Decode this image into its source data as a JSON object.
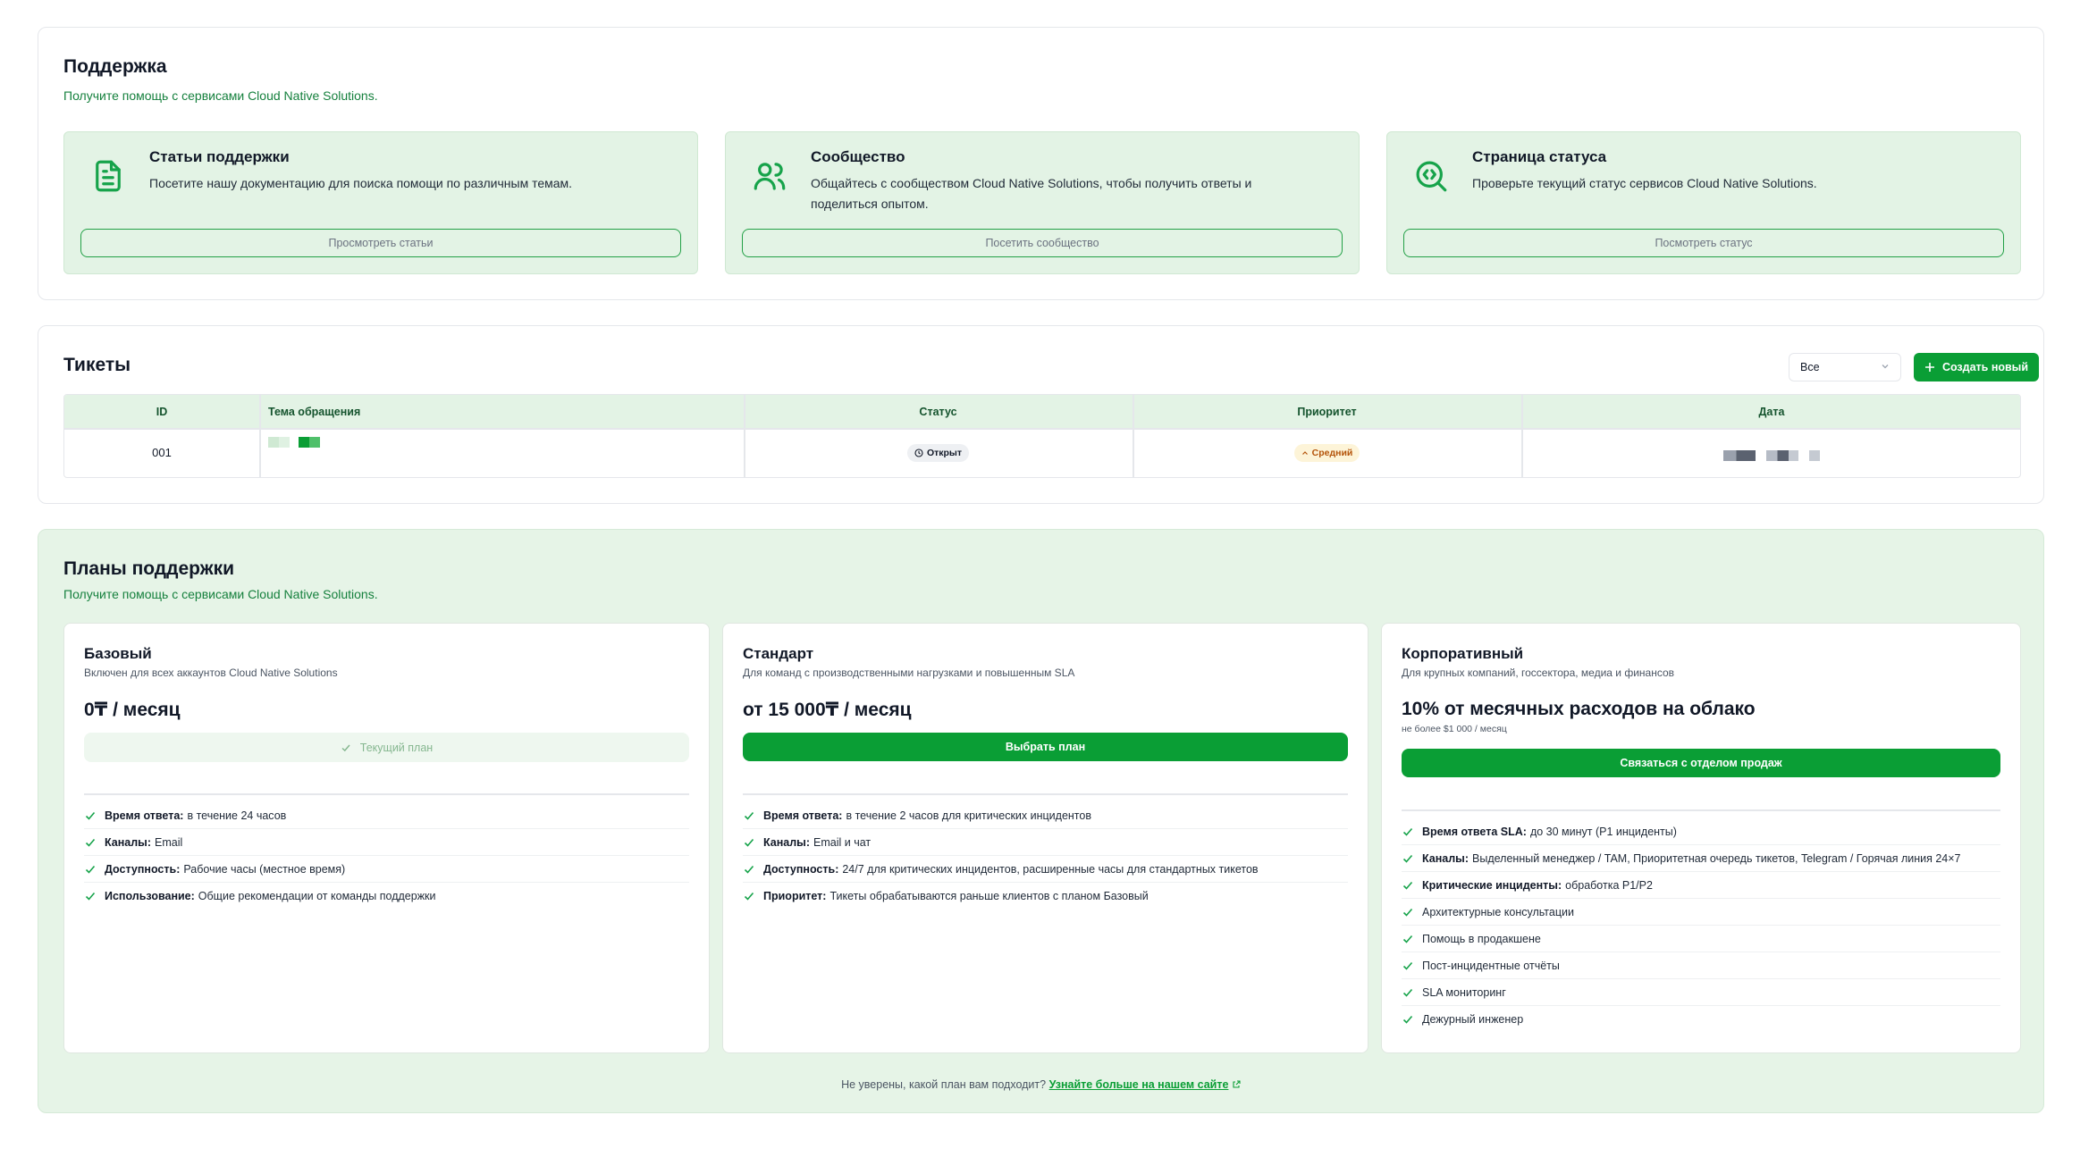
{
  "support": {
    "title": "Поддержка",
    "subtitle": "Получите помощь с сервисами Cloud Native Solutions.",
    "cards": [
      {
        "icon": "document-icon",
        "title": "Статьи поддержки",
        "description": "Посетите нашу документацию для поиска помощи по различным темам.",
        "button": "Просмотреть статьи"
      },
      {
        "icon": "users-icon",
        "title": "Сообщество",
        "description": "Общайтесь с сообществом Cloud Native Solutions, чтобы получить ответы и поделиться опытом.",
        "button": "Посетить сообщество"
      },
      {
        "icon": "status-search-icon",
        "title": "Страница статуса",
        "description": "Проверьте текущий статус сервисов Cloud Native Solutions.",
        "button": "Посмотреть статус"
      }
    ]
  },
  "tickets": {
    "title": "Тикеты",
    "filter_value": "Все",
    "create_button": "Создать новый",
    "columns": [
      "ID",
      "Тема обращения",
      "Статус",
      "Приоритет",
      "Дата"
    ],
    "rows": [
      {
        "id": "001",
        "status": "Открыт",
        "priority": "Средний"
      }
    ]
  },
  "plans": {
    "title": "Планы поддержки",
    "subtitle": "Получите помощь с сервисами Cloud Native Solutions.",
    "items": [
      {
        "name": "Базовый",
        "description": "Включен для всех аккаунтов Cloud Native Solutions",
        "price": "0₸ / месяц",
        "button": "Текущий план",
        "features": [
          {
            "label": "Время ответа:",
            "text": "в течение 24 часов"
          },
          {
            "label": "Каналы:",
            "text": "Email"
          },
          {
            "label": "Доступность:",
            "text": "Рабочие часы (местное время)"
          },
          {
            "label": "Использование:",
            "text": "Общие рекомендации от команды поддержки"
          }
        ]
      },
      {
        "name": "Стандарт",
        "description": "Для команд с производственными нагрузками и повышенным SLA",
        "price": "от 15 000₸ / месяц",
        "button": "Выбрать план",
        "features": [
          {
            "label": "Время ответа:",
            "text": "в течение 2 часов для критических инцидентов"
          },
          {
            "label": "Каналы:",
            "text": "Email и чат"
          },
          {
            "label": "Доступность:",
            "text": "24/7 для критических инцидентов, расширенные часы для стандартных тикетов"
          },
          {
            "label": "Приоритет:",
            "text": "Тикеты обрабатываются раньше клиентов с планом Базовый"
          }
        ]
      },
      {
        "name": "Корпоративный",
        "description": "Для крупных компаний, госсектора, медиа и финансов",
        "price": "10% от месячных расходов на облако",
        "price_note": "не более $1 000 / месяц",
        "button": "Связаться с отделом продаж",
        "features": [
          {
            "label": "Время ответа SLA:",
            "text": "до 30 минут (P1 инциденты)"
          },
          {
            "label": "Каналы:",
            "text": "Выделенный менеджер / TAM, Приоритетная очередь тикетов, Telegram / Горячая линия 24×7"
          },
          {
            "label": "Критические инциденты:",
            "text": "обработка P1/P2"
          },
          {
            "label": "",
            "text": "Архитектурные консультации"
          },
          {
            "label": "",
            "text": "Помощь в продакшене"
          },
          {
            "label": "",
            "text": "Пост-инцидентные отчёты"
          },
          {
            "label": "",
            "text": "SLA мониторинг"
          },
          {
            "label": "",
            "text": "Дежурный инженер"
          }
        ]
      }
    ],
    "footnote_text": "Не уверены, какой план вам подходит?",
    "footnote_link": "Узнайте больше на нашем сайте"
  },
  "colors": {
    "brand_green": "#0a9e35",
    "card_green": "#e3f3e5",
    "section_green": "#e6f4e7"
  }
}
